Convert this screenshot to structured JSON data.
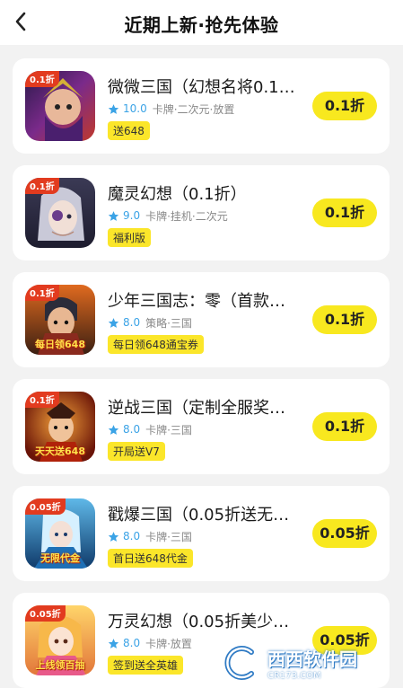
{
  "header": {
    "title": "近期上新·抢先体验",
    "back_icon": "chevron-left-icon"
  },
  "colors": {
    "accent_yellow": "#f8e81f",
    "rating_blue": "#3ba3e6",
    "card_bg": "#ffffff",
    "page_bg": "#f2f2f2"
  },
  "games": [
    {
      "name": "微微三国（幻想名将0.1…",
      "rating": "10.0",
      "tags": "卡牌·二次元·放置",
      "badge": "送648",
      "discount": "0.1折",
      "icon_tag": "0.1折",
      "icon_caption": ""
    },
    {
      "name": "魔灵幻想（0.1折）",
      "rating": "9.0",
      "tags": "卡牌·挂机·二次元",
      "badge": "福利版",
      "discount": "0.1折",
      "icon_tag": "0.1折",
      "icon_caption": ""
    },
    {
      "name": "少年三国志：零（首款…",
      "rating": "8.0",
      "tags": "策略·三国",
      "badge": "每日领648通宝券",
      "discount": "0.1折",
      "icon_tag": "0.1折",
      "icon_caption": "每日领648"
    },
    {
      "name": "逆战三国（定制全服奖…",
      "rating": "8.0",
      "tags": "卡牌·三国",
      "badge": "开局送V7",
      "discount": "0.1折",
      "icon_tag": "0.1折",
      "icon_caption": "天天送648"
    },
    {
      "name": "戳爆三国（0.05折送无…",
      "rating": "8.0",
      "tags": "卡牌·三国",
      "badge": "首日送648代金",
      "discount": "0.05折",
      "icon_tag": "0.05折",
      "icon_caption": "无限代金"
    },
    {
      "name": "万灵幻想（0.05折美少…",
      "rating": "8.0",
      "tags": "卡牌·放置",
      "badge": "签到送全英雄",
      "discount": "0.05折",
      "icon_tag": "0.05折",
      "icon_caption": "上线领百抽"
    }
  ],
  "watermark": {
    "text": "西西软件园",
    "sub": "CR173.COM"
  }
}
